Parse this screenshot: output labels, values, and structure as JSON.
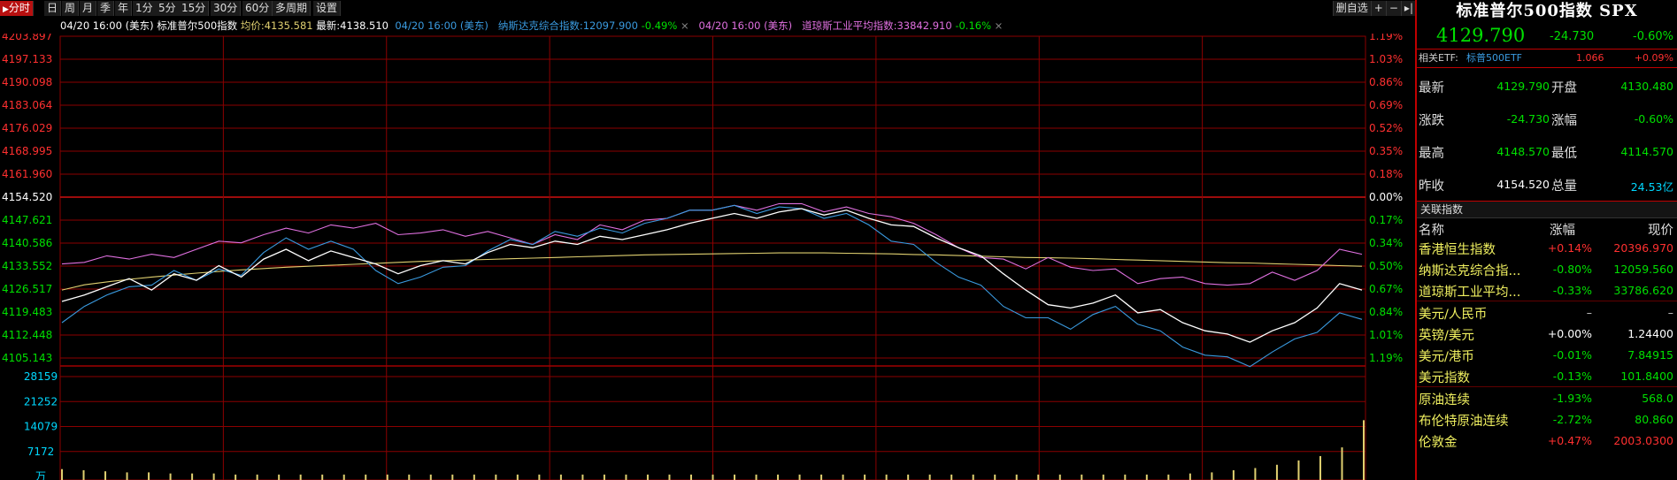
{
  "toolbar": {
    "periods": [
      "分时",
      "日",
      "周",
      "月",
      "季",
      "年",
      "1分",
      "5分",
      "15分",
      "30分",
      "60分",
      "多周期",
      "设置"
    ],
    "active": "分时",
    "right": [
      "删自选",
      "+",
      "−",
      "▸|"
    ]
  },
  "legend": {
    "main": {
      "time": "04/20 16:00 (美东)",
      "name": "标准普尔500指数",
      "avg_label": "均价:",
      "avg": "4135.581",
      "last_label": "最新:",
      "last": "4138.510"
    },
    "cmp1": {
      "time": "04/20 16:00 (美东)",
      "name": "纳斯达克综合指数:",
      "value": "12097.900",
      "pct": "-0.49%",
      "close": "×"
    },
    "cmp2": {
      "time": "04/20 16:00 (美东)",
      "name": "道琼斯工业平均指数:",
      "value": "33842.910",
      "pct": "-0.16%",
      "close": "×"
    }
  },
  "chart_data": {
    "type": "line",
    "price_axis": [
      "4203.897",
      "4197.133",
      "4190.098",
      "4183.064",
      "4176.029",
      "4168.995",
      "4161.960",
      "4154.520",
      "4147.621",
      "4140.586",
      "4133.552",
      "4126.517",
      "4119.483",
      "4112.448",
      "4105.143"
    ],
    "pct_axis": [
      "1.19%",
      "1.03%",
      "0.86%",
      "0.69%",
      "0.52%",
      "0.35%",
      "0.18%",
      "0.00%",
      "0.17%",
      "0.34%",
      "0.50%",
      "0.67%",
      "0.84%",
      "1.01%",
      "1.19%"
    ],
    "prev_close": 4154.52,
    "ylim": [
      4105.143,
      4203.897
    ],
    "vol_axis": [
      "28159",
      "21252",
      "14079",
      "7172",
      "万"
    ],
    "series": [
      {
        "name": "标准普尔500指数",
        "color": "#ffffff",
        "values": [
          4122.5,
          4124.5,
          4127.0,
          4129.5,
          4126.0,
          4131.0,
          4129.0,
          4133.5,
          4130.0,
          4135.5,
          4138.5,
          4135.0,
          4138.0,
          4136.0,
          4134.0,
          4131.0,
          4133.5,
          4135.0,
          4134.0,
          4137.5,
          4140.0,
          4139.0,
          4141.0,
          4140.0,
          4142.5,
          4141.5,
          4143.0,
          4144.5,
          4146.5,
          4148.0,
          4149.5,
          4148.0,
          4150.0,
          4151.0,
          4149.0,
          4150.5,
          4148.0,
          4146.0,
          4145.5,
          4142.0,
          4139.0,
          4136.5,
          4131.0,
          4126.0,
          4121.5,
          4120.5,
          4122.0,
          4124.5,
          4119.0,
          4120.0,
          4116.0,
          4113.5,
          4112.5,
          4110.0,
          4113.5,
          4116.0,
          4120.5,
          4128.0,
          4126.0
        ]
      },
      {
        "name": "纳斯达克综合指数",
        "color": "#3a9adf",
        "values": [
          4116.0,
          4121.0,
          4124.5,
          4127.0,
          4127.5,
          4132.0,
          4129.0,
          4132.5,
          4130.5,
          4137.5,
          4142.0,
          4138.5,
          4141.0,
          4138.5,
          4132.0,
          4128.0,
          4130.0,
          4133.0,
          4133.5,
          4138.0,
          4141.5,
          4140.0,
          4144.0,
          4142.5,
          4145.0,
          4143.5,
          4146.5,
          4148.0,
          4150.5,
          4150.5,
          4152.0,
          4149.5,
          4151.5,
          4151.0,
          4148.0,
          4149.5,
          4146.0,
          4141.0,
          4140.0,
          4134.5,
          4130.0,
          4127.5,
          4121.0,
          4117.5,
          4117.5,
          4114.0,
          4118.5,
          4121.0,
          4115.5,
          4113.5,
          4108.5,
          4106.0,
          4105.5,
          4102.5,
          4107.0,
          4111.0,
          4113.0,
          4119.0,
          4117.0
        ]
      },
      {
        "name": "道琼斯工业平均指数",
        "color": "#e070e0",
        "values": [
          4134.0,
          4134.5,
          4136.5,
          4135.5,
          4137.0,
          4136.0,
          4138.5,
          4141.0,
          4140.5,
          4143.0,
          4145.0,
          4143.5,
          4146.0,
          4145.0,
          4146.5,
          4143.0,
          4143.5,
          4144.5,
          4142.5,
          4144.0,
          4142.0,
          4140.0,
          4143.0,
          4141.5,
          4146.0,
          4144.5,
          4147.5,
          4148.0,
          4150.5,
          4150.5,
          4152.0,
          4150.5,
          4152.5,
          4152.5,
          4150.0,
          4151.5,
          4149.5,
          4148.5,
          4146.5,
          4143.0,
          4139.0,
          4136.0,
          4135.5,
          4132.5,
          4136.0,
          4133.0,
          4132.0,
          4132.5,
          4128.0,
          4129.5,
          4130.0,
          4128.0,
          4127.5,
          4128.0,
          4131.5,
          4129.0,
          4132.0,
          4138.5,
          4137.0
        ]
      },
      {
        "name": "均价",
        "color": "#e0d070",
        "values": [
          4126.0,
          4127.6,
          4128.5,
          4129.3,
          4130.0,
          4130.6,
          4131.2,
          4131.7,
          4132.2,
          4132.6,
          4133.0,
          4133.3,
          4133.6,
          4133.9,
          4134.2,
          4134.5,
          4134.8,
          4135.0,
          4135.2,
          4135.4,
          4135.6,
          4135.8,
          4136.0,
          4136.2,
          4136.4,
          4136.6,
          4136.8,
          4136.9,
          4137.0,
          4137.1,
          4137.2,
          4137.3,
          4137.4,
          4137.4,
          4137.4,
          4137.3,
          4137.2,
          4137.1,
          4136.9,
          4136.8,
          4136.6,
          4136.4,
          4136.2,
          4136.0,
          4135.9,
          4135.8,
          4135.6,
          4135.4,
          4135.2,
          4135.0,
          4134.8,
          4134.6,
          4134.4,
          4134.3,
          4134.1,
          4133.9,
          4133.7,
          4133.5,
          4133.3
        ]
      }
    ],
    "volume": [
      0.1,
      0.09,
      0.08,
      0.07,
      0.07,
      0.06,
      0.06,
      0.06,
      0.05,
      0.05,
      0.05,
      0.05,
      0.05,
      0.05,
      0.05,
      0.05,
      0.05,
      0.05,
      0.05,
      0.05,
      0.05,
      0.05,
      0.05,
      0.05,
      0.05,
      0.05,
      0.05,
      0.05,
      0.05,
      0.05,
      0.05,
      0.05,
      0.05,
      0.05,
      0.05,
      0.05,
      0.05,
      0.05,
      0.05,
      0.05,
      0.05,
      0.05,
      0.05,
      0.05,
      0.05,
      0.05,
      0.05,
      0.05,
      0.05,
      0.05,
      0.05,
      0.05,
      0.06,
      0.07,
      0.09,
      0.11,
      0.14,
      0.18,
      0.22,
      0.3,
      0.55
    ]
  },
  "panel": {
    "title": "标准普尔500指数 SPX",
    "last": "4129.790",
    "change": "-24.730",
    "pct": "-0.60%",
    "etf": {
      "label": "相关ETF:",
      "name": "标普500ETF",
      "price": "1.066",
      "pct": "+0.09%"
    },
    "stats": [
      {
        "k1": "最新",
        "v1": "4129.790",
        "k2": "开盘",
        "v2": "4130.480",
        "c1": "#00e000",
        "c2": "#00e000"
      },
      {
        "k1": "涨跌",
        "v1": "-24.730",
        "k2": "涨幅",
        "v2": "-0.60%",
        "c1": "#00e000",
        "c2": "#00e000"
      },
      {
        "k1": "最高",
        "v1": "4148.570",
        "k2": "最低",
        "v2": "4114.570",
        "c1": "#00e000",
        "c2": "#00e000"
      },
      {
        "k1": "昨收",
        "v1": "4154.520",
        "k2": "总量",
        "v2": "24.53亿",
        "c1": "#ffffff",
        "c2": "#00d8ff"
      }
    ],
    "related_title": "关联指数",
    "related_head": {
      "name": "名称",
      "pct": "涨幅",
      "price": "现价"
    },
    "related": [
      {
        "name": "香港恒生指数",
        "pct": "+0.14%",
        "price": "20396.970",
        "color": "#ff3030"
      },
      {
        "name": "纳斯达克综合指...",
        "pct": "-0.80%",
        "price": "12059.560",
        "color": "#00e000"
      },
      {
        "name": "道琼斯工业平均...",
        "pct": "-0.33%",
        "price": "33786.620",
        "color": "#00e000"
      },
      {
        "name": "美元/人民币",
        "pct": "–",
        "price": "–",
        "color": "#cccccc"
      },
      {
        "name": "英镑/美元",
        "pct": "+0.00%",
        "price": "1.24400",
        "color": "#ffffff"
      },
      {
        "name": "美元/港币",
        "pct": "-0.01%",
        "price": "7.84915",
        "color": "#00e000"
      },
      {
        "name": "美元指数",
        "pct": "-0.13%",
        "price": "101.8400",
        "color": "#00e000"
      },
      {
        "name": "原油连续",
        "pct": "-1.93%",
        "price": "568.0",
        "color": "#00e000"
      },
      {
        "name": "布伦特原油连续",
        "pct": "-2.72%",
        "price": "80.860",
        "color": "#00e000"
      },
      {
        "name": "伦敦金",
        "pct": "+0.47%",
        "price": "2003.0300",
        "color": "#ff3030"
      }
    ]
  }
}
